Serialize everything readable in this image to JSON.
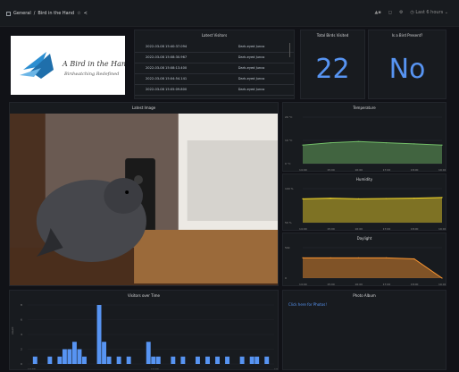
{
  "topbar": {
    "breadcrumb_folder": "General",
    "breadcrumb_sep": "/",
    "breadcrumb_title": "Bird in the Hand",
    "time_range": "Last 6 hours"
  },
  "logo": {
    "title": "A Bird in the Hand",
    "subtitle": "Birdwatching Redefined"
  },
  "latest_visitors": {
    "title": "Latest Visitors",
    "rows": [
      [
        "2022-03-08 15:40:37.094",
        "Dark-eyed Junco"
      ],
      [
        "2022-03-08 15:08:30.967",
        "Dark-eyed Junco"
      ],
      [
        "2022-03-08 15:08:13.400",
        "Dark-eyed Junco"
      ],
      [
        "2022-03-08 15:04:54.141",
        "Dark-eyed Junco"
      ],
      [
        "2022-03-08 15:05:09.800",
        "Dark-eyed Junco"
      ]
    ]
  },
  "total_birds": {
    "title": "Total Birds Visited",
    "value": "22"
  },
  "bird_present": {
    "title": "Is a Bird Present?",
    "value": "No"
  },
  "latest_image": {
    "title": "Latest Image"
  },
  "temperature": {
    "title": "Temperature",
    "y_ticks": [
      "20 °C",
      "10 °C",
      "0 °C"
    ],
    "x_ticks": [
      "14:00",
      "15:00",
      "16:00",
      "17:00",
      "18:00",
      "19:00"
    ]
  },
  "humidity": {
    "title": "Humidity",
    "y_ticks": [
      "100 %",
      "50 %"
    ],
    "x_ticks": [
      "14:00",
      "15:00",
      "16:00",
      "17:00",
      "18:00",
      "19:00"
    ]
  },
  "daylight": {
    "title": "Daylight",
    "y_ticks": [
      "50k",
      "0"
    ],
    "x_ticks": [
      "14:00",
      "15:00",
      "16:00",
      "17:00",
      "18:00",
      "19:00"
    ],
    "legend": "Photo-RTS mean   Last *: 1"
  },
  "visitors_over_time": {
    "title": "Visitors over Time",
    "ylabel": "count",
    "y_ticks": [
      "8",
      "6",
      "4",
      "2",
      "0"
    ],
    "x_ticks": [
      "12:00",
      "14:00",
      "17:00"
    ]
  },
  "photo_album": {
    "title": "Photo Album",
    "link": "Click here for Photos!"
  },
  "colors": {
    "background": "#111217",
    "panel": "#181b1f",
    "accent_blue": "#5794f2",
    "temp_green": "#73bf69",
    "humidity_yellow": "#fade2a",
    "daylight_orange": "#ff9830",
    "bar_blue": "#5794f2"
  },
  "chart_data": [
    {
      "type": "area",
      "title": "Temperature",
      "x": [
        "14:00",
        "15:00",
        "16:00",
        "17:00",
        "18:00",
        "19:00"
      ],
      "series": [
        {
          "values": [
            8,
            9,
            9.5,
            9,
            8.5,
            8
          ]
        }
      ],
      "ylim": [
        0,
        20
      ]
    },
    {
      "type": "area",
      "title": "Humidity",
      "x": [
        "14:00",
        "15:00",
        "16:00",
        "17:00",
        "18:00",
        "19:00"
      ],
      "series": [
        {
          "values": [
            70,
            72,
            70,
            71,
            72,
            74
          ]
        }
      ],
      "ylim": [
        0,
        100
      ]
    },
    {
      "type": "area",
      "title": "Daylight",
      "x": [
        "14:00",
        "15:00",
        "16:00",
        "17:00",
        "18:00",
        "19:00"
      ],
      "series": [
        {
          "name": "Photo-RTS mean",
          "values": [
            40000,
            40000,
            40000,
            40000,
            38000,
            0
          ]
        }
      ],
      "ylim": [
        0,
        60000
      ]
    },
    {
      "type": "bar",
      "title": "Visitors over Time",
      "ylabel": "count",
      "values": [
        0,
        1,
        0,
        0,
        1,
        0,
        1,
        2,
        2,
        3,
        2,
        1,
        0,
        0,
        8,
        3,
        1,
        0,
        1,
        0,
        1,
        0,
        0,
        0,
        3,
        1,
        1,
        0,
        0,
        1,
        0,
        1,
        0,
        0,
        1,
        0,
        1,
        0,
        1,
        0,
        1,
        0,
        0,
        1,
        0,
        1,
        1,
        0,
        1,
        0
      ],
      "ylim": [
        0,
        8
      ]
    }
  ]
}
